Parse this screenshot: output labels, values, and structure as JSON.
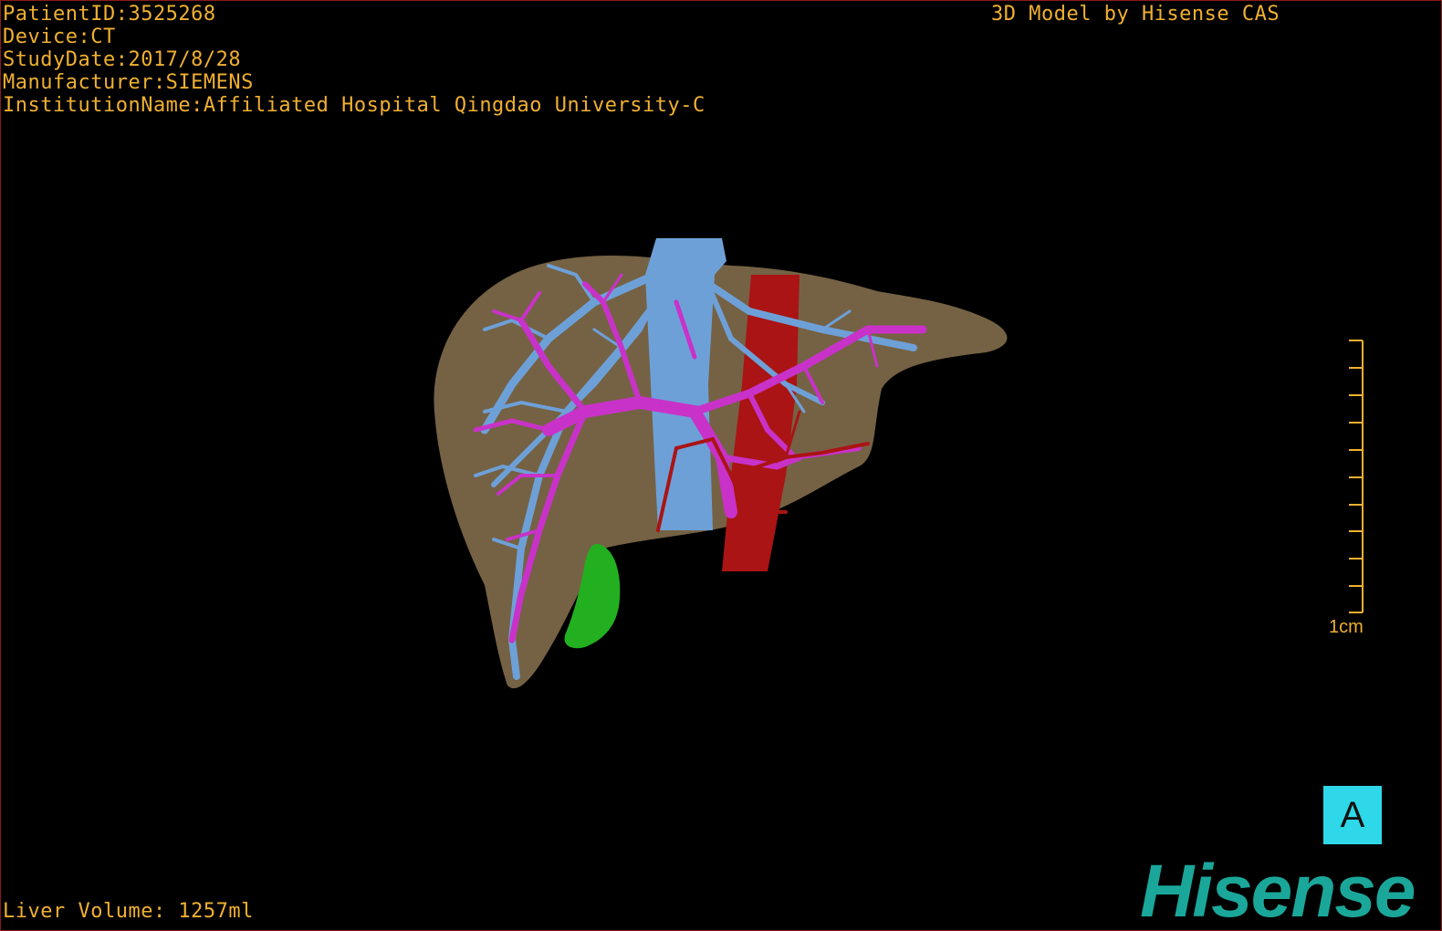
{
  "header": {
    "patient_id": "PatientID:3525268",
    "device": "Device:CT",
    "study_date": "StudyDate:2017/8/28",
    "manufacturer": "Manufacturer:SIEMENS",
    "institution": "InstitutionName:Affiliated Hospital Qingdao University-C"
  },
  "vendor_label": "3D Model by Hisense CAS",
  "footer": {
    "liver_volume": "Liver Volume: 1257ml"
  },
  "scale_bar": {
    "label": "1cm"
  },
  "orientation": {
    "label": "A"
  },
  "brand": {
    "label": "Hisense"
  },
  "colors": {
    "text": "#f0b030",
    "liver": "#8a7350",
    "hepatic_vein": "#6ea0d8",
    "portal_vein": "#c832c8",
    "artery": "#aa1414",
    "gallbladder": "#22b020",
    "orientation_box": "#2ed8e8",
    "brand": "#1aa79a",
    "border": "#8a1a1a"
  }
}
